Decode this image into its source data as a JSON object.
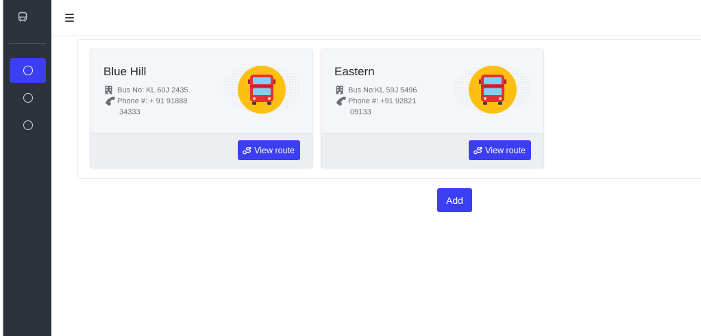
{
  "sidebar": {
    "logo_icon": "bus-icon",
    "items": [
      {
        "icon": "circle-icon",
        "active": true
      },
      {
        "icon": "circle-icon",
        "active": false
      },
      {
        "icon": "circle-icon",
        "active": false
      }
    ]
  },
  "topbar": {
    "menu_icon": "hamburger-icon"
  },
  "buses": [
    {
      "name": "Blue Hill",
      "bus_no": "Bus No: KL 60J 2435",
      "phone_line1": "Phone #: + 91 91888",
      "phone_line2": "34333",
      "button": "View route"
    },
    {
      "name": "Eastern",
      "bus_no": "Bus No:KL 59J 5496",
      "phone_line1": "Phone #: +91 92821",
      "phone_line2": "09133",
      "button": "View route"
    }
  ],
  "add_button": "Add",
  "colors": {
    "accent": "#3b3ef2",
    "sidebar": "#2d323b",
    "bus_badge": "#fdbf12",
    "bus_body": "#e5303a"
  }
}
